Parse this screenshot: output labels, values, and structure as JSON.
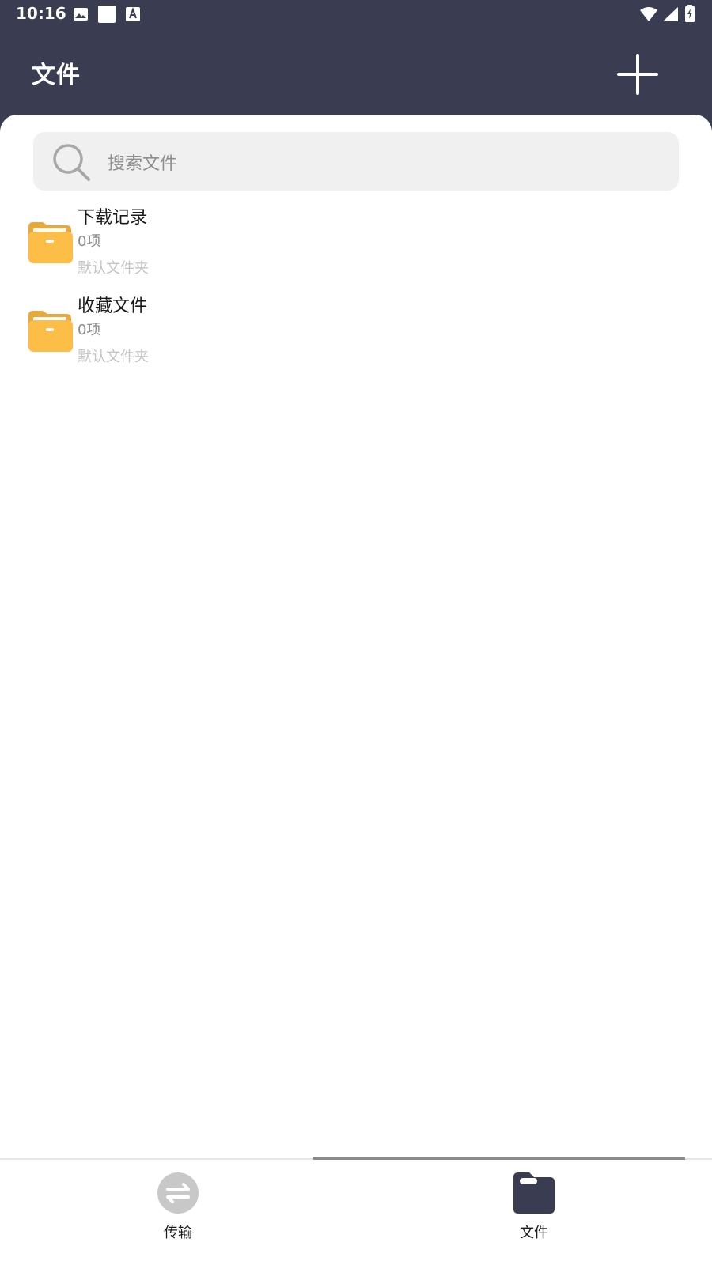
{
  "status_bar": {
    "time": "10:16",
    "icons": [
      "image-icon",
      "square-icon",
      "a-icon",
      "wifi-icon",
      "signal-icon",
      "battery-icon"
    ]
  },
  "header": {
    "title": "文件",
    "add_icon": "plus-icon"
  },
  "search": {
    "placeholder": "搜索文件"
  },
  "folders": [
    {
      "name": "下载记录",
      "count": "0项",
      "description": "默认文件夹"
    },
    {
      "name": "收藏文件",
      "count": "0项",
      "description": "默认文件夹"
    }
  ],
  "bottom_nav": {
    "items": [
      {
        "label": "传输",
        "icon": "transfer-icon",
        "active": false
      },
      {
        "label": "文件",
        "icon": "folder-icon",
        "active": true
      }
    ]
  },
  "colors": {
    "header_bg": "#3a3d52",
    "folder": "#fdbe47",
    "folder_back": "#e9a93a",
    "search_bg": "#f0f0f0",
    "inactive_icon": "#c8c8c8"
  }
}
